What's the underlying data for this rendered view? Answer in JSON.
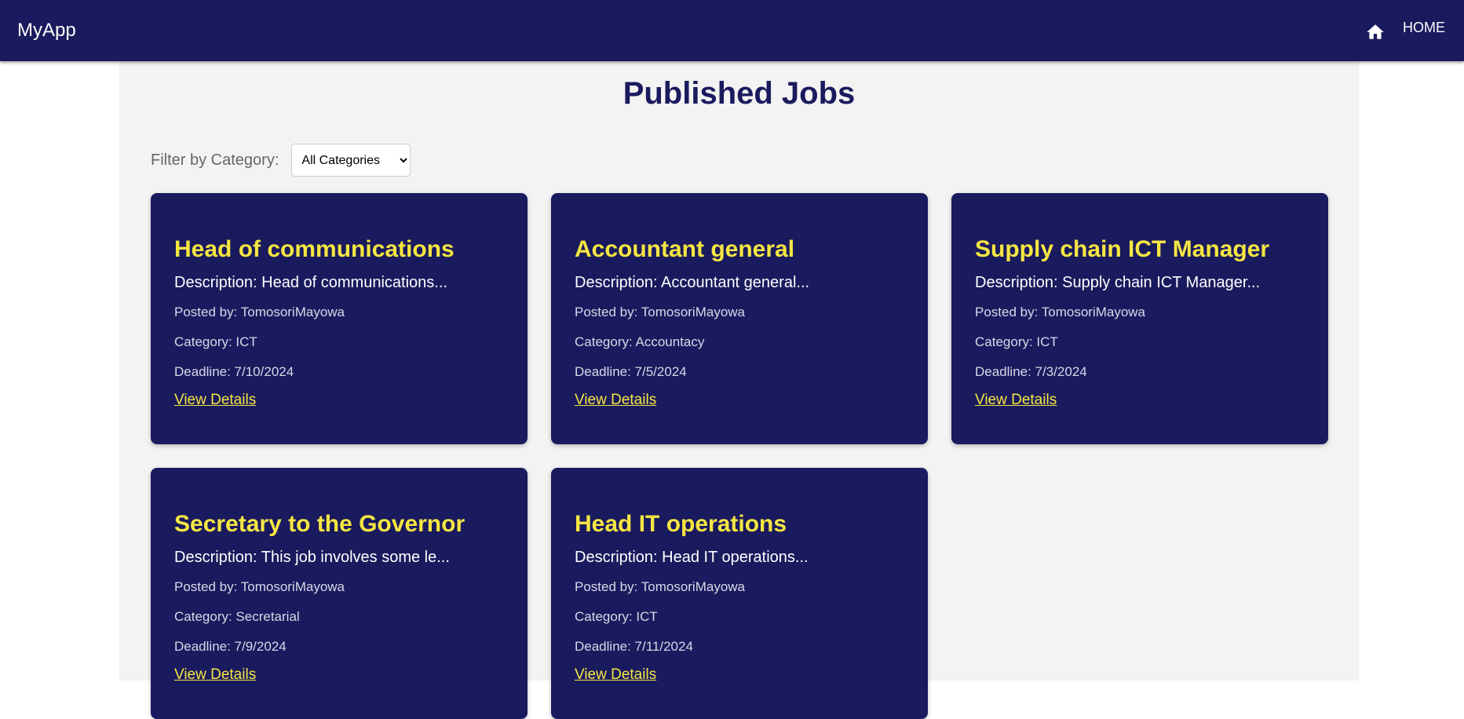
{
  "appbar": {
    "brand": "MyApp",
    "home_label": "HOME",
    "home_icon": "home-icon"
  },
  "page": {
    "title": "Published Jobs"
  },
  "filter": {
    "label": "Filter by Category:",
    "selected": "All Categories"
  },
  "jobs": [
    {
      "title": "Head of communications",
      "description": "Description: Head of communications...",
      "posted_by": "Posted by: TomosoriMayowa",
      "category": "Category: ICT",
      "deadline": "Deadline: 7/10/2024",
      "link": "View Details"
    },
    {
      "title": "Accountant general",
      "description": "Description: Accountant general...",
      "posted_by": "Posted by: TomosoriMayowa",
      "category": "Category: Accountacy",
      "deadline": "Deadline: 7/5/2024",
      "link": "View Details"
    },
    {
      "title": "Supply chain ICT Manager",
      "description": "Description: Supply chain ICT Manager...",
      "posted_by": "Posted by: TomosoriMayowa",
      "category": "Category: ICT",
      "deadline": "Deadline: 7/3/2024",
      "link": "View Details"
    },
    {
      "title": "Secretary to the Governor",
      "description": "Description: This job involves some le...",
      "posted_by": "Posted by: TomosoriMayowa",
      "category": "Category: Secretarial",
      "deadline": "Deadline: 7/9/2024",
      "link": "View Details"
    },
    {
      "title": "Head IT operations",
      "description": "Description: Head IT operations...",
      "posted_by": "Posted by: TomosoriMayowa",
      "category": "Category: ICT",
      "deadline": "Deadline: 7/11/2024",
      "link": "View Details"
    }
  ],
  "colors": {
    "navy": "#1a1a5e",
    "accent_yellow": "#f5e642",
    "page_background": "#f3f3f3"
  }
}
